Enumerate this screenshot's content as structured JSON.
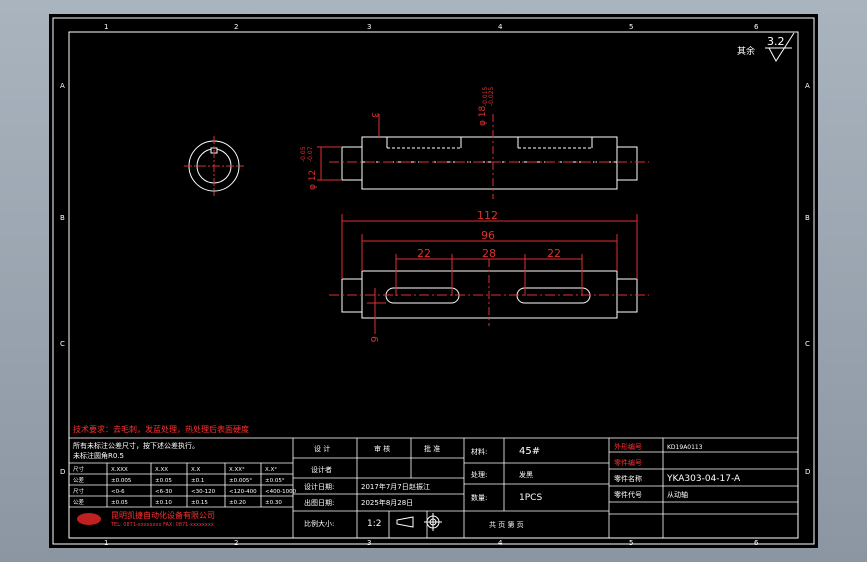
{
  "zone_columns": [
    "1",
    "2",
    "3",
    "4",
    "5",
    "6"
  ],
  "zone_rows": [
    "A",
    "B",
    "C",
    "D"
  ],
  "surface_finish": {
    "label": "其余",
    "value": "3.2"
  },
  "dimensions": {
    "keyway_depth": "3",
    "shaft_dia": "φ 18",
    "shaft_dia_tol": "-0.015",
    "shaft_dia_tol_b": "-0.025",
    "end_dia": "φ 12",
    "end_dia_tol": "-0.05",
    "end_dia_tol_b": "-0.07",
    "overall_length": "112",
    "inner_length": "96",
    "slot_1": "22",
    "slot_mid": "28",
    "slot_2": "22",
    "slot_width": "6"
  },
  "notes": {
    "technical_requirements": "技术要求：去毛刺，发蓝处理，热处理后表面硬度",
    "tolerance_note_1": "所有未标注公差尺寸，按下述公差执行。",
    "tolerance_note_2": "未标注圆角R0.5"
  },
  "tolerance_table": {
    "headers": [
      "尺寸",
      "X.XXX",
      "X.XX",
      "X.X",
      "X.XX°",
      "X.X°"
    ],
    "rows": [
      [
        "公差",
        "±0.005",
        "±0.05",
        "±0.1",
        "±0.005°",
        "±0.05°"
      ],
      [
        "尺寸",
        "<0-6",
        "<6-30",
        "<30-120",
        "<120-400",
        "<400-1000"
      ],
      [
        "公差",
        "±0.05",
        "±0.10",
        "±0.15",
        "±0.20",
        "±0.30"
      ]
    ]
  },
  "title_block": {
    "design_label": "设 计",
    "review_label": "审 核",
    "approve_label": "批 准",
    "designer_label": "设计者",
    "design_date_label": "设计日期:",
    "design_date": "2017年7月7日",
    "drafter": "赵振江",
    "issue_date_label": "出图日期:",
    "issue_date": "2025年8月28日",
    "scale_label": "比例大小:",
    "scale": "1:2",
    "material_label": "材料:",
    "material": "45#",
    "treatment_label": "处理:",
    "treatment": "发黑",
    "quantity_label": "数量:",
    "quantity": "1PCS",
    "sheet_label": "共 页 第 页",
    "drawing_no_label": "外形编号",
    "drawing_no": "KD19A0113",
    "part_no_label": "零件编号",
    "part_no": "YKA303-04-17-A",
    "part_name_label": "零件名称",
    "part_name": "从动轴",
    "part_code_label": "零件代号",
    "company": "昆明凯捷自动化设备有限公司",
    "company_addr": "TEL: 0871-xxxxxxxx  FAX: 0871-xxxxxxxx"
  }
}
